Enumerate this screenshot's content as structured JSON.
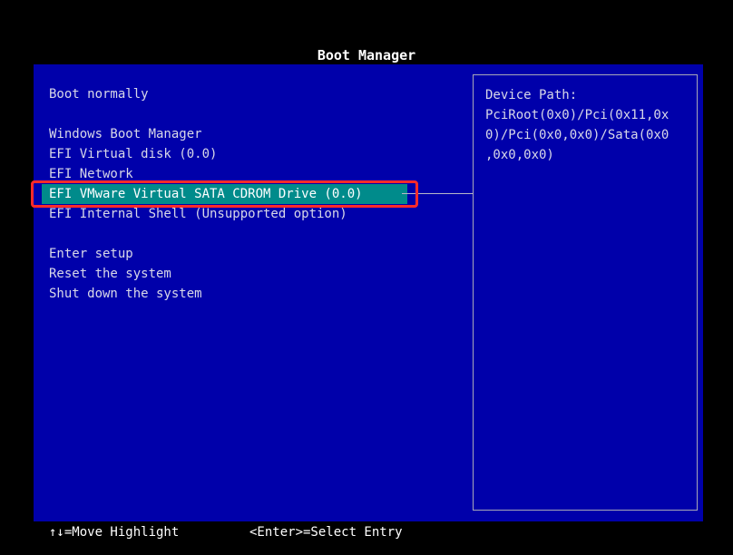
{
  "title": "Boot Manager",
  "menu": {
    "items": [
      "Boot normally",
      "Windows Boot Manager",
      "EFI Virtual disk (0.0)",
      "EFI Network",
      "EFI VMware Virtual SATA CDROM Drive (0.0)",
      "EFI Internal Shell (Unsupported option)",
      "Enter setup",
      "Reset the system",
      "Shut down the system"
    ],
    "selected_index": 4
  },
  "info": {
    "lines": [
      "Device Path:",
      "PciRoot(0x0)/Pci(0x11,0x",
      "0)/Pci(0x0,0x0)/Sata(0x0",
      ",0x0,0x0)"
    ]
  },
  "footer": {
    "move_hint": "↑↓=Move Highlight",
    "enter_hint": "<Enter>=Select Entry"
  },
  "colors": {
    "background": "#000000",
    "panel": "#0000aa",
    "selection": "#008b8b",
    "annotation": "#ff2a2a"
  }
}
